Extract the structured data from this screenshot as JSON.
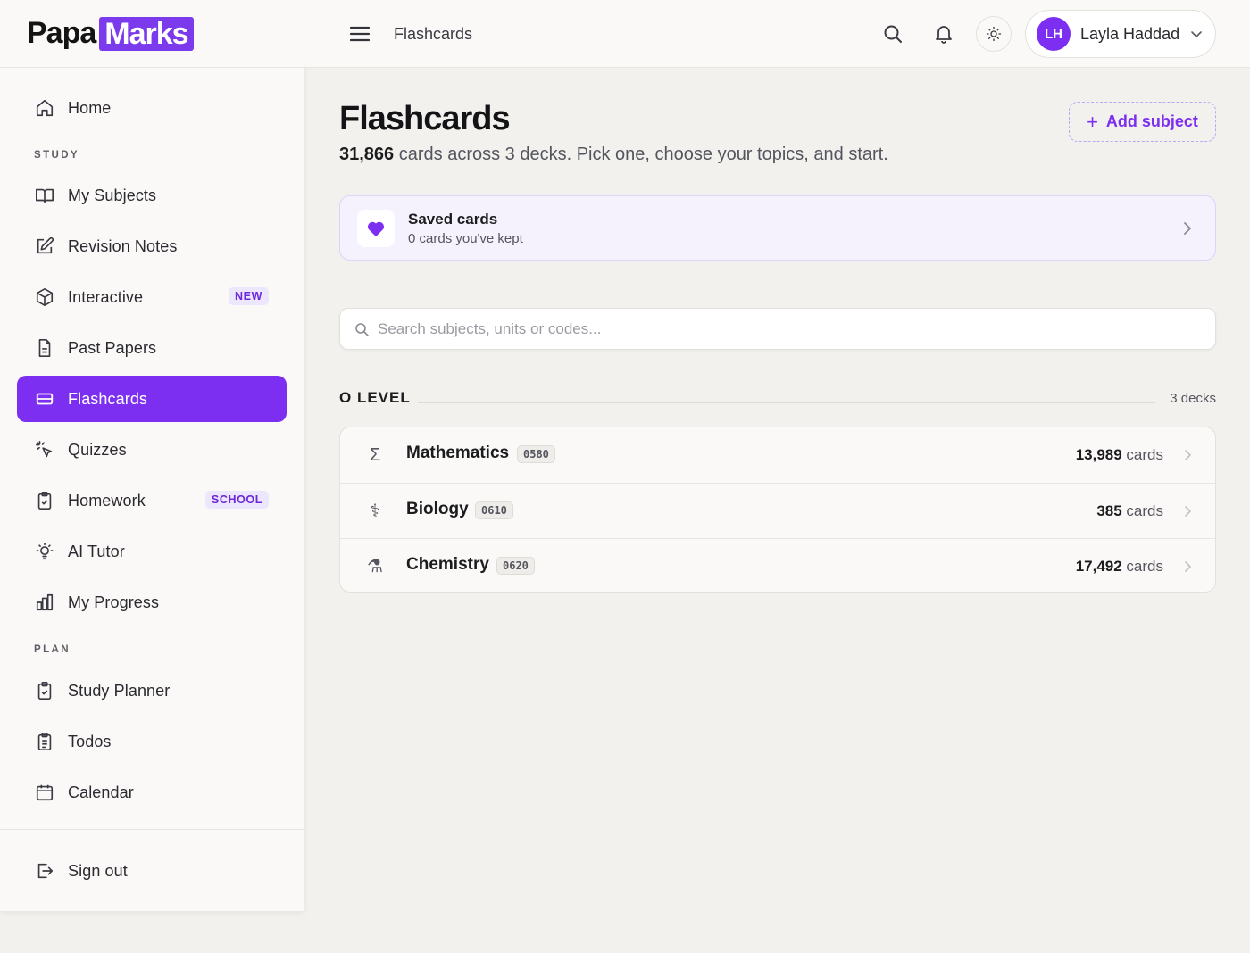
{
  "brand": {
    "part1": "Papa",
    "part2": "Marks"
  },
  "topbar": {
    "breadcrumb": "Flashcards",
    "user": {
      "initials": "LH",
      "name": "Layla Haddad"
    }
  },
  "sidebar": {
    "items": [
      {
        "label": "Home",
        "icon": "home-icon"
      },
      {
        "label": "My Subjects",
        "icon": "book-open-icon"
      },
      {
        "label": "Revision Notes",
        "icon": "edit-icon"
      },
      {
        "label": "Interactive",
        "icon": "cube-icon",
        "badge": "NEW"
      },
      {
        "label": "Past Papers",
        "icon": "document-icon"
      },
      {
        "label": "Flashcards",
        "icon": "cards-icon",
        "active": true
      },
      {
        "label": "Quizzes",
        "icon": "cursor-click-icon"
      },
      {
        "label": "Homework",
        "icon": "clipboard-check-icon",
        "badge": "SCHOOL"
      },
      {
        "label": "AI Tutor",
        "icon": "bulb-icon"
      },
      {
        "label": "My Progress",
        "icon": "bar-chart-icon"
      },
      {
        "label": "Study Planner",
        "icon": "clipboard-check-icon"
      },
      {
        "label": "Todos",
        "icon": "clipboard-list-icon"
      },
      {
        "label": "Calendar",
        "icon": "calendar-icon"
      }
    ],
    "sections": {
      "study": "STUDY",
      "plan": "PLAN"
    },
    "signout": "Sign out"
  },
  "main": {
    "title": "Flashcards",
    "subtitle_count": "31,866",
    "subtitle_rest": " cards across 3 decks. Pick one, choose your topics, and start.",
    "add_button": "Add subject",
    "saved": {
      "title": "Saved cards",
      "subtitle": "0 cards you've kept"
    },
    "search_placeholder": "Search subjects, units or codes...",
    "level": {
      "label": "O LEVEL",
      "count": "3 decks"
    },
    "decks": [
      {
        "name": "Mathematics",
        "code": "0580",
        "count": "13,989",
        "unit": " cards",
        "icon": "sigma-icon",
        "glyph": "Σ"
      },
      {
        "name": "Biology",
        "code": "0610",
        "count": "385",
        "unit": " cards",
        "icon": "dna-icon",
        "glyph": "⚕"
      },
      {
        "name": "Chemistry",
        "code": "0620",
        "count": "17,492",
        "unit": " cards",
        "icon": "flask-icon",
        "glyph": "⚗"
      }
    ]
  },
  "colors": {
    "accent": "#7c2ff0",
    "background": "#f2f1ee",
    "surface": "#faf9f7"
  }
}
